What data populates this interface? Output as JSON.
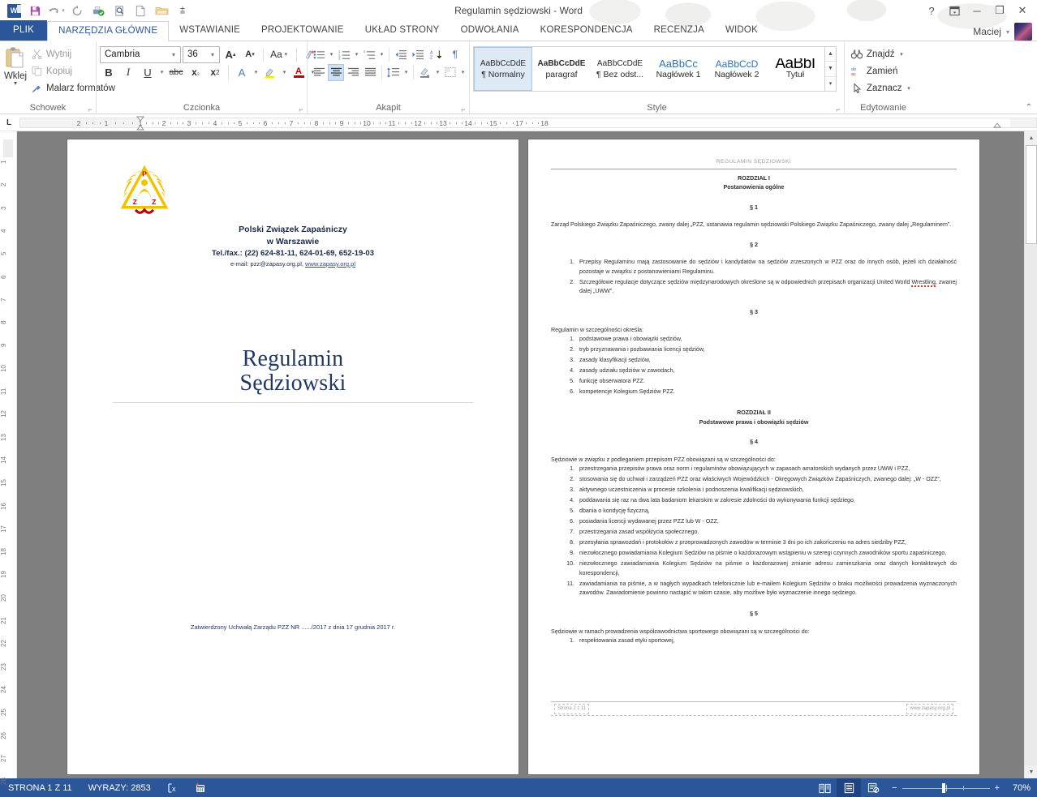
{
  "window": {
    "title": "Regulamin sędziowski - Word",
    "qat": [
      {
        "name": "word-logo",
        "label": "W"
      },
      {
        "name": "save-icon",
        "label": "Zapisz"
      },
      {
        "name": "undo-icon",
        "label": "Cofnij"
      },
      {
        "name": "redo-icon",
        "label": "Ponów"
      },
      {
        "name": "quick-print-icon",
        "label": "Szybkie drukowanie"
      },
      {
        "name": "print-preview-icon",
        "label": "Podgląd wydruku"
      },
      {
        "name": "new-document-icon",
        "label": "Nowy"
      },
      {
        "name": "open-icon",
        "label": "Otwórz"
      },
      {
        "name": "customize-qat-icon",
        "label": "Dostosuj pasek narzędzi Szybki dostęp"
      }
    ],
    "buttons": {
      "help": "?",
      "ribbon_display": "▣",
      "minimize": "─",
      "restore": "❐",
      "close": "✕"
    },
    "user": "Maciej"
  },
  "tabs": [
    {
      "label": "PLIK",
      "active": false,
      "file": true
    },
    {
      "label": "NARZĘDZIA GŁÓWNE",
      "active": true
    },
    {
      "label": "WSTAWIANIE",
      "active": false
    },
    {
      "label": "PROJEKTOWANIE",
      "active": false
    },
    {
      "label": "UKŁAD STRONY",
      "active": false
    },
    {
      "label": "ODWOŁANIA",
      "active": false
    },
    {
      "label": "KORESPONDENCJA",
      "active": false
    },
    {
      "label": "RECENZJA",
      "active": false
    },
    {
      "label": "WIDOK",
      "active": false
    }
  ],
  "ribbon": {
    "clipboard": {
      "group_label": "Schowek",
      "paste": "Wklej",
      "cut": "Wytnij",
      "copy": "Kopiuj",
      "format_painter": "Malarz formatów"
    },
    "font": {
      "group_label": "Czcionka",
      "font_name": "Cambria",
      "font_size": "36",
      "grow": "A",
      "shrink": "A",
      "change_case": "Aa",
      "clear_formatting": "⌫",
      "bold": "B",
      "italic": "I",
      "underline": "U",
      "strikethrough": "abc",
      "subscript": "x₂",
      "superscript": "x²",
      "text_effects": "A",
      "highlight": "ab",
      "font_color": "A"
    },
    "paragraph": {
      "group_label": "Akapit",
      "bullets": "•≡",
      "numbering": "1≡",
      "multilevel": "⁵≡",
      "decrease_indent": "⇤",
      "increase_indent": "⇥",
      "sort": "A↓Z",
      "show_marks": "¶",
      "align_left": "≡",
      "align_center": "≡",
      "align_right": "≡",
      "justify": "≡",
      "line_spacing": "↕≡",
      "shading": "▨",
      "borders": "▦"
    },
    "styles": {
      "group_label": "Style",
      "items": [
        {
          "preview": "AaBbCcDdE",
          "name": "¶ Normalny",
          "selected": true,
          "kind": "normal"
        },
        {
          "preview": "AaBbCcDdE",
          "name": "paragraf",
          "selected": false,
          "kind": "bold"
        },
        {
          "preview": "AaBbCcDdE",
          "name": "¶ Bez odst...",
          "selected": false,
          "kind": "normal"
        },
        {
          "preview": "AaBbCc",
          "name": "Nagłówek 1",
          "selected": false,
          "kind": "h1"
        },
        {
          "preview": "AaBbCcD",
          "name": "Nagłówek 2",
          "selected": false,
          "kind": "h2"
        },
        {
          "preview": "AaBbI",
          "name": "Tytuł",
          "selected": false,
          "kind": "title"
        }
      ]
    },
    "editing": {
      "group_label": "Edytowanie",
      "find": "Znajdź",
      "replace": "Zamień",
      "select": "Zaznacz"
    },
    "collapse": "⌃"
  },
  "ruler": {
    "tab_selector": "L",
    "horizontal_ticks": [
      "2",
      "1",
      "1",
      "2",
      "3",
      "4",
      "5",
      "6",
      "7",
      "8",
      "9",
      "10",
      "11",
      "12",
      "13",
      "14",
      "15",
      "17",
      "18"
    ],
    "vertical_ticks": [
      "1",
      "2",
      "3",
      "4",
      "5",
      "6",
      "7",
      "8",
      "9",
      "10",
      "11",
      "12",
      "13",
      "14",
      "15",
      "16",
      "17",
      "18",
      "19",
      "20",
      "21",
      "22",
      "23",
      "24",
      "25",
      "26",
      "27",
      "28"
    ]
  },
  "document": {
    "page1": {
      "logo": {
        "letters": [
          "P",
          "Z",
          "Z"
        ],
        "alt": "Polski Związek Zapaśniczy emblem"
      },
      "org_line1": "Polski Związek Zapaśniczy",
      "org_line2": "w Warszawie",
      "phone": "Tel./fax.: (22) 624-81-11, 624-01-69, 652-19-03",
      "email_prefix": "e-mail: pzz@zapasy.org.pl, ",
      "email_link": "www.zapasy.org.pl",
      "title_line1": "Regulamin",
      "title_line2": "Sędziowski",
      "approval": "Zatwierdzony Uchwałą Zarządu PZZ  NR ....../2017 z dnia  17 grudnia 2017  r."
    },
    "page2": {
      "header": "REGULAMIN SĘDZIOWSKI",
      "chapter1_title": "ROZDZIAŁ I",
      "chapter1_subtitle": "Postanowienia ogólne",
      "par1_mark": "§ 1",
      "par1_text": "Zarząd Polskiego Związku Zapaśniczego, zwany dalej „PZZ, ustanawia regulamin sędziowski Polskiego Związku Zapaśniczego, zwany dalej „Regulaminem”.",
      "par2_mark": "§ 2",
      "par2_items": [
        "Przepisy Regulaminu mają zastosowanie do sędziów i kandydatów na sędziów zrzeszonych w PZZ oraz do innych osób, jeżeli ich działalność pozostaje w związku z postanowieniami Regulaminu.",
        "Szczegółowe regulacje dotyczące sędziów międzynarodowych określone są w odpowiednich przepisach organizacji United World Wrestling, zwanej dalej „UWW”."
      ],
      "par3_mark": "§ 3",
      "par3_intro": "Regulamin w szczególności określa:",
      "par3_items": [
        "podstawowe prawa i obowiązki sędziów,",
        "tryb przyznawania i pozbawiania licencji sędziów,",
        "zasady klasyfikacji sędziów,",
        "zasady udziału sędziów w zawodach,",
        "funkcję obserwatora PZZ.",
        "kompetencje Kolegium Sędziów PZZ."
      ],
      "chapter2_title": "ROZDZIAŁ II",
      "chapter2_subtitle": "Podstawowe prawa i obowiązki sędziów",
      "par4_mark": "§ 4",
      "par4_intro": "Sędziowie w związku z podleganiem przepisom PZZ obowiązani są w szczególności do:",
      "par4_items": [
        "przestrzegania przepisów prawa oraz norm i regulaminów obowiązujących w zapasach amatorskich wydanych przez UWW i PZZ,",
        "stosowania się do uchwał i zarządzeń PZZ oraz właściwych Wojewódzkich -  Okręgowych Związków Zapaśniczych, zwanego dalej: „W - OZZ”,",
        "aktywnego uczestniczenia w procesie szkolenia i podnoszenia kwalifikacji sędziowskich,",
        "poddawania się raz na dwa lata badaniom lekarskim w zakresie zdolności do wykonywania funkcji sędziego,",
        "dbania o kondycję fizyczną,",
        "posiadania licencji wydawanej przez PZZ lub W - OZZ,",
        "przestrzegania zasad współżycia społecznego.",
        "przesyłania sprawozdań i protokołów z przeprowadzonych zawodów w terminie 3 dni po ich zakończeniu na adres siedziby PZZ,",
        "niezwłocznego powiadamiania Kolegium Sędziów na piśmie o każdorazowym wstąpieniu w szeregi czynnych zawodników sportu zapaśniczego,",
        "niezwłocznego zawiadamiania Kolegium Sędziów na piśmie o każdorazowej zmianie adresu zamieszkania oraz danych kontaktowych do korespondencji,",
        "zawiadamiania na piśmie, a w nagłych wypadkach telefonicznie lub e-mailem Kolegium Sędziów o braku możliwości prowadzenia wyznaczonych zawodów. Zawiadomienie powinno nastąpić w takim czasie, aby możliwe było wyznaczenie innego sędziego."
      ],
      "par5_mark": "§ 5",
      "par5_intro": "Sędziowie w ramach prowadzenia współzawodnictwa sportowego obowiązani są w szczególności do:",
      "par5_items": [
        "respektowania zasad etyki sportowej,"
      ],
      "footer_left": "Strona 2 z 11",
      "footer_right": "www.zapasy.org.pl"
    }
  },
  "status": {
    "page": "STRONA 1 Z 11",
    "words": "WYRAZY: 2853",
    "proofing_icon": "proofing-errors-icon",
    "macro_icon": "macro-record-icon",
    "views": [
      {
        "name": "read-mode-view",
        "label": "Tryb odczytu",
        "selected": false
      },
      {
        "name": "print-layout-view",
        "label": "Układ wydruku",
        "selected": true
      },
      {
        "name": "web-layout-view",
        "label": "Układ sieci Web",
        "selected": false
      }
    ],
    "zoom_out": "−",
    "zoom_in": "+",
    "zoom": "70%"
  },
  "colors": {
    "word_blue": "#2b579a",
    "accent_tab": "#2b579a",
    "title_navy": "#1f3864",
    "page_bg": "#7f7f7f",
    "style_blue": "#2e74b5"
  }
}
